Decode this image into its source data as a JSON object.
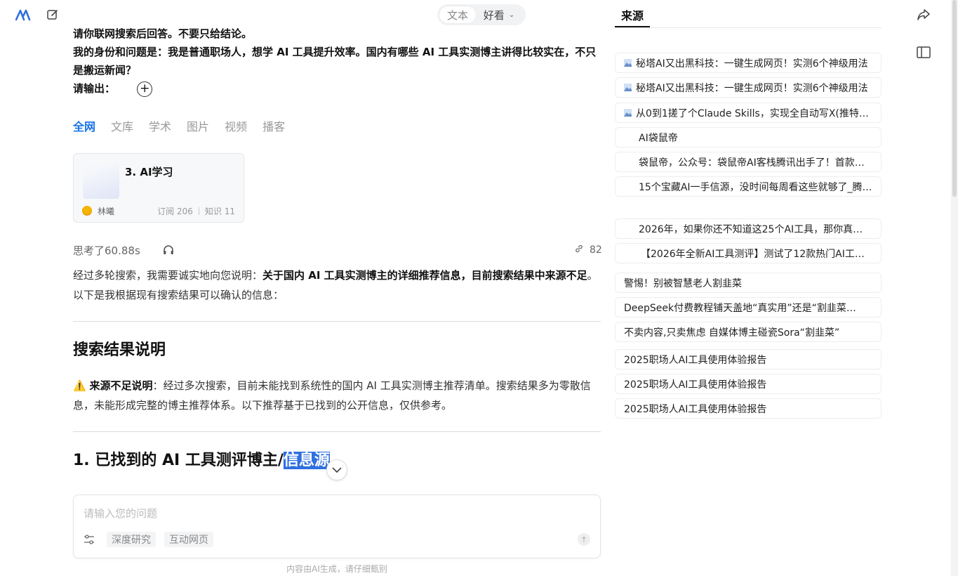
{
  "toolbar": {
    "logo_icon": "app-logo-icon",
    "edit_icon": "edit-icon"
  },
  "view_toggle": {
    "text_label": "文本",
    "pretty_label": "好看"
  },
  "query": {
    "line1": "请你联网搜索后回答。不要只给结论。",
    "line2": "我的身份和问题是：我是普通职场人，想学 AI 工具提升效率。国内有哪些 AI 工具实测博主讲得比较实在，不只是搬运新闻？",
    "line3": "请输出："
  },
  "tabs": [
    "全网",
    "文库",
    "学术",
    "图片",
    "视频",
    "播客"
  ],
  "card": {
    "title": "3. AI学习",
    "author": "林曦",
    "subs": "订阅 206",
    "knowledge": "知识 11"
  },
  "think": {
    "label": "思考了60.88s",
    "link_count": "82"
  },
  "answer": {
    "intro_plain": "经过多轮搜索，我需要诚实地向您说明：",
    "intro_bold": "关于国内 AI 工具实测博主的详细推荐信息，目前搜索结果中来源不足",
    "intro_tail": "。以下是我根据现有搜索结果可以确认的信息：",
    "section_title": "搜索结果说明",
    "warn_icon": "⚠️",
    "warn_bold": "来源不足说明",
    "warn_text": "：经过多次搜索，目前未能找到系统性的国内 AI 工具实测博主推荐清单。搜索结果多为零散信息，未能形成完整的博主推荐体系。以下推荐基于已找到的公开信息，仅供参考。",
    "h3_plain": "1. 已找到的 AI 工具测评博主/",
    "h3_selected": "信息源"
  },
  "input": {
    "placeholder": "请输入您的问题",
    "chip_deep": "深度研究",
    "chip_web": "互动网页",
    "disclaimer": "内容由AI生成，请仔细甄别"
  },
  "sources": {
    "title": "来源",
    "items": [
      "秘塔AI又出黑科技：一键生成网页！实测6个神级用法",
      "秘塔AI又出黑科技：一键生成网页！实测6个神级用法",
      "从0到1搓了个Claude Skills，实现全自动写X(推特)…",
      "AI袋鼠帝",
      "袋鼠帝，公众号：袋鼠帝AI客栈腾讯出手了！首款…",
      "15个宝藏AI一手信源，没时间每周看这些就够了_腾…",
      "2026年，如果你还不知道这25个AI工具，那你真的…",
      "【2026年全新AI工具测评】测试了12款热门AI工具…",
      "警惕！别被智慧老人割韭菜",
      "DeepSeek付费教程铺天盖地“真实用”还是“割韭菜…",
      "不卖内容,只卖焦虑 自媒体博主碰瓷Sora“割韭菜”",
      "2025职场人AI工具使用体验报告",
      "2025职场人AI工具使用体验报告",
      "2025职场人AI工具使用体验报告"
    ]
  }
}
